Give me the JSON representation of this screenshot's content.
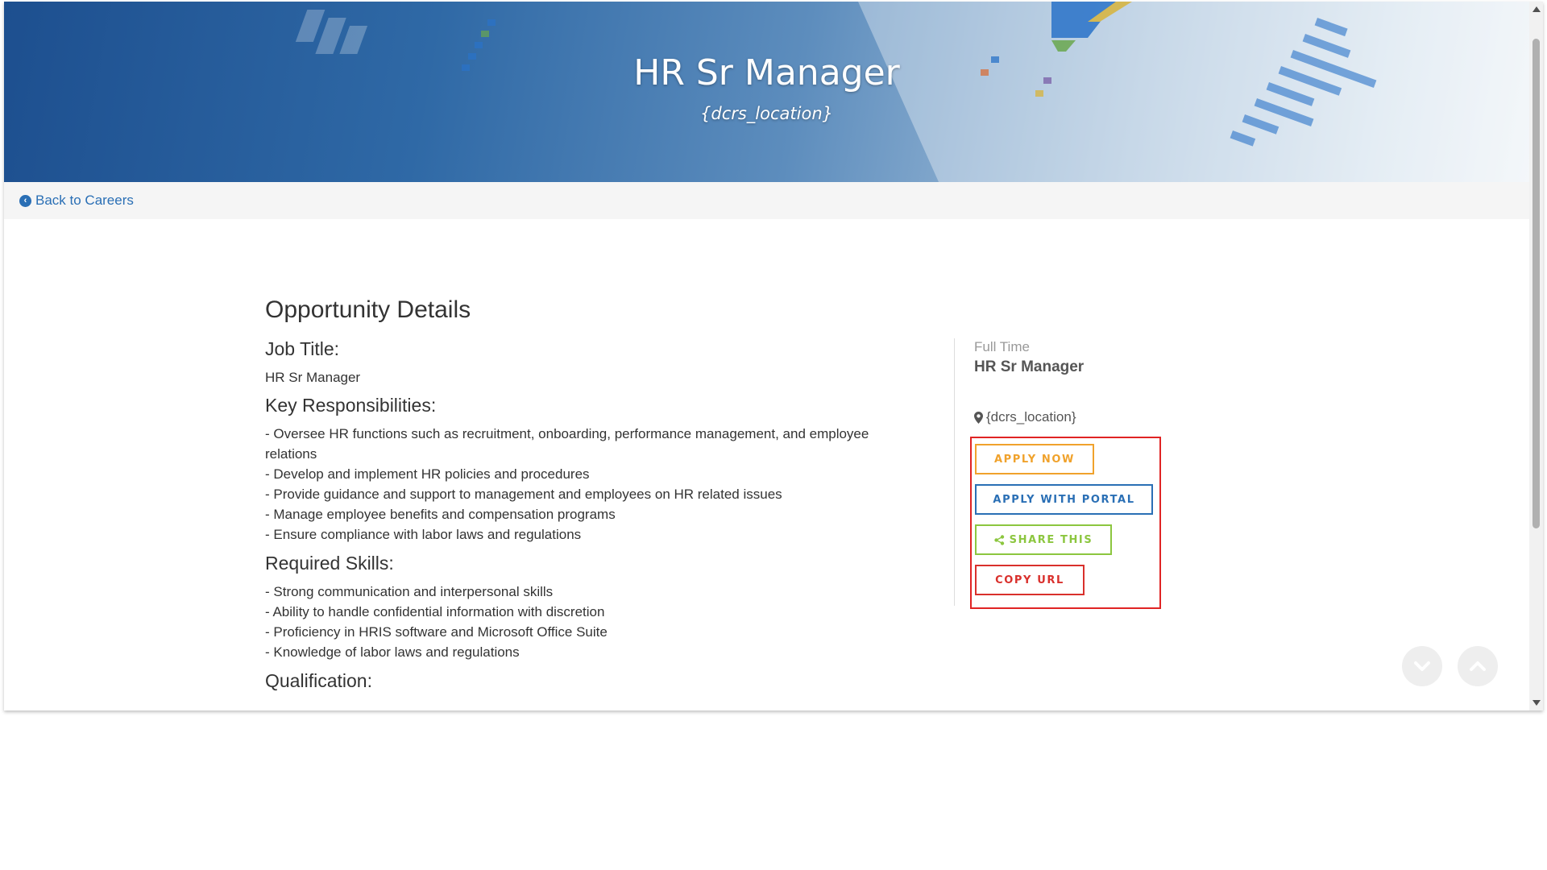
{
  "hero": {
    "title": "HR Sr Manager",
    "location": "{dcrs_location}"
  },
  "nav": {
    "back_label": "Back to Careers"
  },
  "details": {
    "heading": "Opportunity Details",
    "job_title_heading": "Job Title:",
    "job_title": "HR Sr Manager",
    "responsibilities_heading": "Key Responsibilities:",
    "responsibilities": [
      "- Oversee HR functions such as recruitment, onboarding, performance management, and employee relations",
      "- Develop and implement HR policies and procedures",
      "- Provide guidance and support to management and employees on HR related issues",
      "- Manage employee benefits and compensation programs",
      "- Ensure compliance with labor laws and regulations"
    ],
    "skills_heading": "Required Skills:",
    "skills": [
      "- Strong communication and interpersonal skills",
      "- Ability to handle confidential information with discretion",
      "- Proficiency in HRIS software and Microsoft Office Suite",
      "- Knowledge of labor laws and regulations"
    ],
    "qualification_heading": "Qualification:"
  },
  "sidebar": {
    "employment_type": "Full Time",
    "title": "HR Sr Manager",
    "location": "{dcrs_location}",
    "buttons": {
      "apply_now": "APPLY NOW",
      "apply_portal": "APPLY WITH PORTAL",
      "share": "SHARE THIS",
      "copy_url": "COPY URL"
    }
  },
  "icons": {
    "back": "chevron-circle-left-icon",
    "location": "map-marker-icon",
    "share": "share-icon",
    "scroll_down": "chevron-down-icon",
    "scroll_up": "chevron-up-icon"
  },
  "colors": {
    "link": "#2a6fb5",
    "apply_now": "#f0a22c",
    "apply_portal": "#2a6fb5",
    "share": "#8cc63f",
    "copy_url": "#d9302c",
    "highlight_box": "#e02424"
  }
}
